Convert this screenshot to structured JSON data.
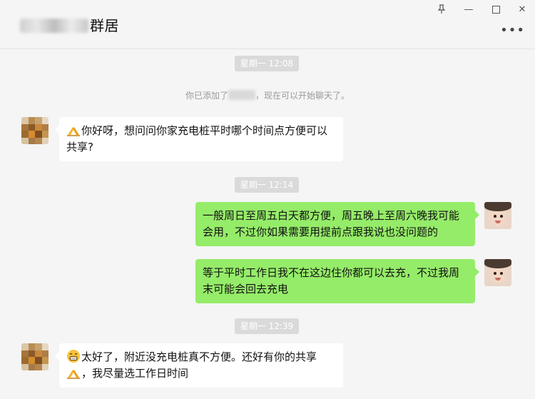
{
  "window": {
    "title_visible": "群居",
    "minimize_glyph": "—",
    "maximize_glyph": "☐",
    "close_glyph": "✕",
    "pin_glyph": "⊥",
    "more_glyph": "•••"
  },
  "chat": {
    "timestamps": [
      "星期一 12:08",
      "星期一 12:14",
      "星期一 12:39"
    ],
    "system_notice": {
      "before": "你已添加了",
      "after": "，现在可以开始聊天了。"
    },
    "messages": [
      {
        "side": "in",
        "emoji": "folded-hands",
        "text": "你好呀，想问问你家充电桩平时哪个时间点方便可以共享?"
      },
      {
        "side": "out",
        "text": "一般周日至周五白天都方便，周五晚上至周六晚我可能会用，不过你如果需要用提前点跟我说也没问题的"
      },
      {
        "side": "out",
        "text": "等于平时工作日我不在这边住你都可以去充，不过我周末可能会回去充电"
      },
      {
        "side": "in",
        "emoji": "grin",
        "text": "太好了，附近没充电桩真不方便。还好有你的共享",
        "emoji2": "folded-hands",
        "text2": "，我尽量选工作日时间"
      }
    ]
  },
  "colors": {
    "background": "#f5f5f5",
    "outgoing_bubble": "#95ec69",
    "incoming_bubble": "#ffffff",
    "timestamp_bg": "#dadada"
  }
}
